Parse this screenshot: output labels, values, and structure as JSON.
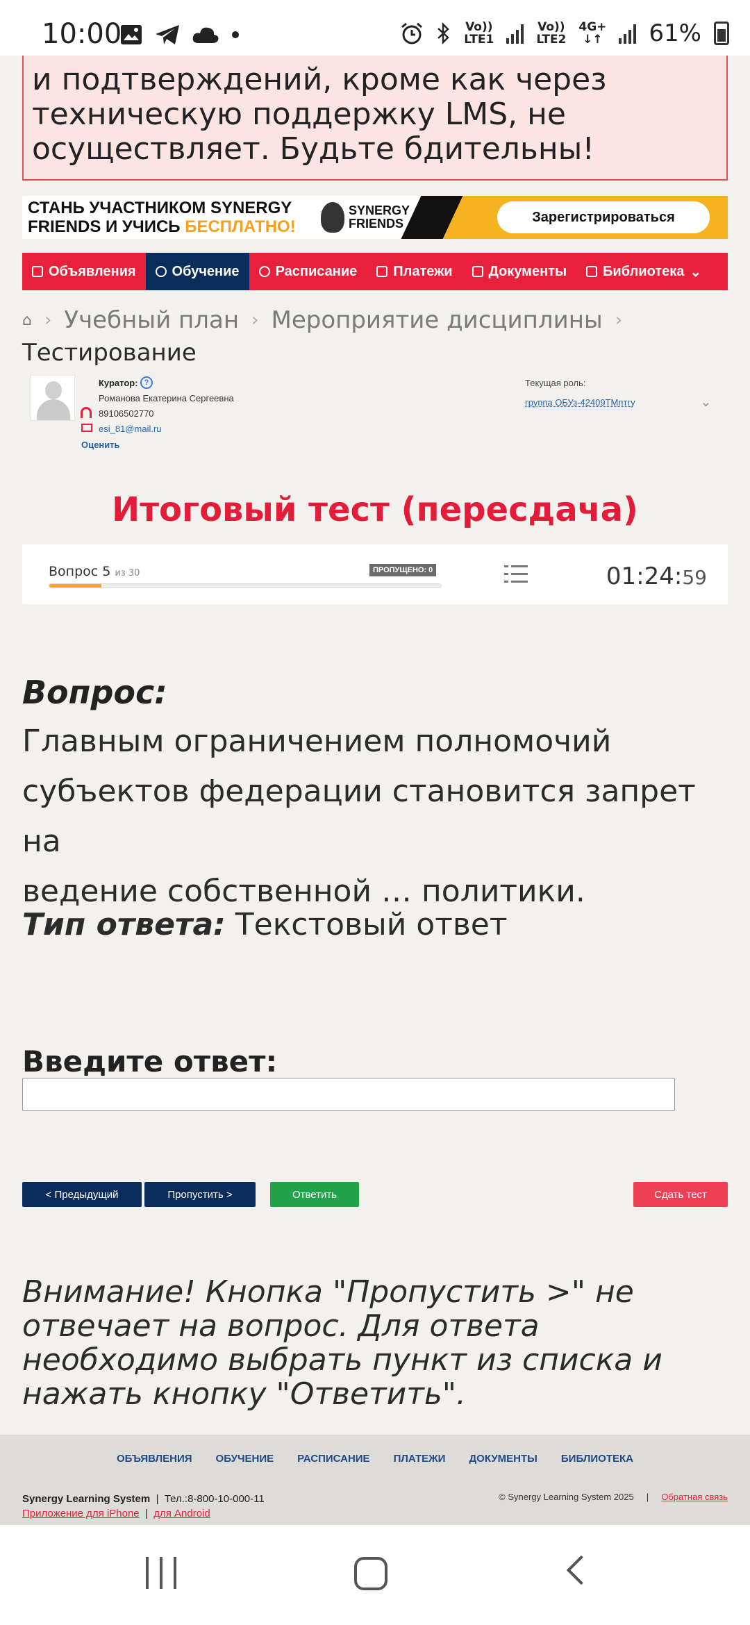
{
  "status_bar": {
    "time": "10:00",
    "net1": [
      "Vo))",
      "LTE1"
    ],
    "net2": [
      "Vo))",
      "LTE2"
    ],
    "net3": "4G+",
    "battery": "61%"
  },
  "warning": {
    "lines": [
      "и подтверждений, кроме как через",
      "техническую поддержку LMS, не",
      "осуществляет. Будьте бдительны!"
    ]
  },
  "banner": {
    "text_line1": "СТАНЬ УЧАСТНИКОМ SYNERGY",
    "text_line2_a": "FRIENDS И УЧИСЬ ",
    "text_line2_b": "БЕСПЛАТНО!",
    "logo_line1": "SYNERGY",
    "logo_line2": "FRIENDS",
    "register_button": "Зарегистрироваться"
  },
  "nav": {
    "items": [
      {
        "label": "Объявления",
        "icon": "announcements-icon"
      },
      {
        "label": "Обучение",
        "icon": "education-icon"
      },
      {
        "label": "Расписание",
        "icon": "clock-icon"
      },
      {
        "label": "Платежи",
        "icon": "payment-icon"
      },
      {
        "label": "Документы",
        "icon": "document-icon"
      },
      {
        "label": "Библиотека",
        "icon": "book-icon"
      }
    ]
  },
  "breadcrumb": {
    "items": [
      "Учебный план",
      "Мероприятие дисциплины"
    ]
  },
  "page_title": "Тестирование",
  "curator": {
    "label": "Куратор:",
    "name": "Романова Екатерина Сергеевна",
    "phone": "89106502770",
    "email": "esi_81@mail.ru",
    "rate_link": "Оценить"
  },
  "role": {
    "label": "Текущая роль:",
    "value": "группа ОБУз-42409ТМптгу"
  },
  "test": {
    "title": "Итоговый тест (пересдача)",
    "question_label": "Вопрос 5",
    "question_of": "из 30",
    "skipped": "ПРОПУЩЕНО: 0",
    "progress": 0.1333,
    "timer_main": "01:24:",
    "timer_sec": "59"
  },
  "question": {
    "heading": "Вопрос:",
    "text_lines": [
      "Главным ограничением полномочий",
      "субъектов федерации становится запрет на",
      "ведение собственной … политики."
    ],
    "type_label": "Тип ответа:",
    "type_value": " Текстовый ответ"
  },
  "answer": {
    "label": "Введите ответ:",
    "value": ""
  },
  "buttons": {
    "prev": "< Предыдущий",
    "skip": "Пропустить >",
    "answer": "Ответить",
    "submit": "Сдать тест"
  },
  "notice": "Внимание! Кнопка \"Пропустить >\" не отвечает на вопрос. Для ответа необходимо выбрать пункт из списка и нажать кнопку \"Ответить\".",
  "footer": {
    "links": [
      "ОБЪЯВЛЕНИЯ",
      "ОБУЧЕНИЕ",
      "РАСПИСАНИЕ",
      "ПЛАТЕЖИ",
      "ДОКУМЕНТЫ",
      "БИБЛИОТЕКА"
    ],
    "company": "Synergy Learning System",
    "phone": "Тел.:8-800-10-000-11",
    "iphone_app": "Приложение для iPhone",
    "android_app": "для Android",
    "copyright": "© Synergy Learning System 2025",
    "feedback": "Обратная связь"
  },
  "colors": {
    "nav_red": "#e8203b",
    "nav_active": "#0b2d5c",
    "title_red": "#e11d3a",
    "answer_green": "#22a34a",
    "submit_red": "#ef3f55"
  }
}
